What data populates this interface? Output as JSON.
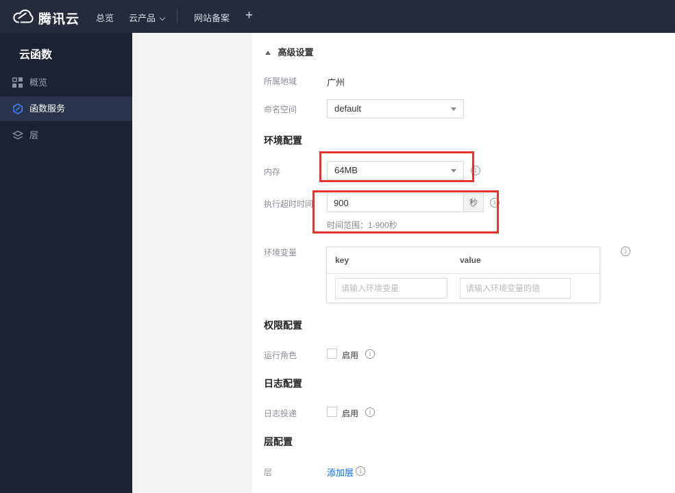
{
  "navbar": {
    "brand": "腾讯云",
    "overview": "总览",
    "products": "云产品",
    "icp": "网站备案",
    "plus": "+"
  },
  "sidebar": {
    "title": "云函数",
    "items": [
      {
        "label": "概览",
        "icon": "grid-icon",
        "active": false
      },
      {
        "label": "函数服务",
        "icon": "hexagon-icon",
        "active": true
      },
      {
        "label": "层",
        "icon": "layers-icon",
        "active": false
      }
    ]
  },
  "content": {
    "advanced_settings": {
      "label": "高级设置"
    },
    "region": {
      "label": "所属地域",
      "value": "广州"
    },
    "namespace": {
      "label": "命名空间",
      "value": "default"
    },
    "section_env": "环境配置",
    "memory": {
      "label": "内存",
      "value": "64MB"
    },
    "timeout": {
      "label": "执行超时时间",
      "value": "900",
      "unit": "秒",
      "hint": "时间范围：1-900秒"
    },
    "env_vars": {
      "label": "环境变量",
      "key_header": "key",
      "value_header": "value",
      "key_placeholder": "请输入环境变量",
      "value_placeholder": "请输入环境变量的值"
    },
    "section_perm": "权限配置",
    "run_role": {
      "label": "运行角色",
      "checkbox_label": "启用"
    },
    "section_log": "日志配置",
    "log_delivery": {
      "label": "日志投递",
      "checkbox_label": "启用"
    },
    "section_layer": "层配置",
    "layer": {
      "label": "层",
      "add_link": "添加层"
    }
  },
  "colors": {
    "accent_red": "#e5342e",
    "link_blue": "#006eff",
    "navbar_bg": "#252b3a",
    "sidebar_bg": "#1c2232"
  }
}
